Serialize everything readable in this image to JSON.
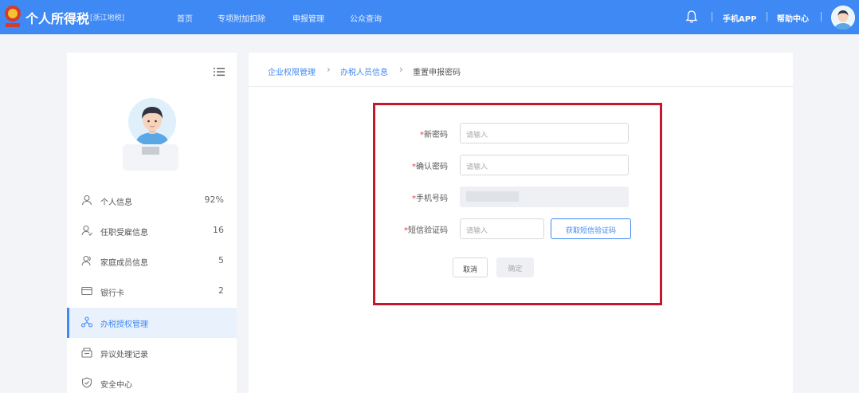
{
  "header": {
    "title": "个人所得税",
    "region": "[浙江地税]",
    "nav": [
      "首页",
      "专项附加扣除",
      "申报管理",
      "公众查询"
    ],
    "mobile_app": "手机APP",
    "help": "帮助中心",
    "colors": {
      "bar": "#3f89f4"
    }
  },
  "sidebar": {
    "items": [
      {
        "label": "个人信息",
        "count": "92%",
        "icon": "person-icon"
      },
      {
        "label": "任职受雇信息",
        "count": "16",
        "icon": "employment-icon"
      },
      {
        "label": "家庭成员信息",
        "count": "5",
        "icon": "family-icon"
      },
      {
        "label": "银行卡",
        "count": "2",
        "icon": "card-icon"
      },
      {
        "label": "办税授权管理",
        "count": "",
        "icon": "authorization-icon",
        "active": true
      },
      {
        "label": "异议处理记录",
        "count": "",
        "icon": "dispute-icon"
      },
      {
        "label": "安全中心",
        "count": "",
        "icon": "shield-icon"
      }
    ]
  },
  "breadcrumb": [
    "企业权限管理",
    "办税人员信息",
    "重置申报密码"
  ],
  "form": {
    "new_password": {
      "label": "新密码",
      "placeholder": "请输入"
    },
    "confirm_password": {
      "label": "确认密码",
      "placeholder": "请输入"
    },
    "phone": {
      "label": "手机号码"
    },
    "sms_code": {
      "label": "短信验证码",
      "placeholder": "请输入",
      "button": "获取短信验证码"
    },
    "required_mark": "*",
    "cancel": "取消",
    "confirm": "确定"
  },
  "highlight_color": "#c6182b"
}
